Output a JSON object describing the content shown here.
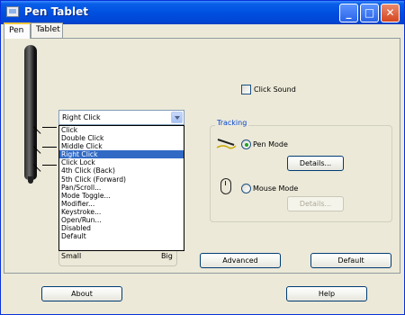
{
  "window": {
    "title": "Pen Tablet",
    "minimize": "_",
    "maximize": "□",
    "close": "✕"
  },
  "tabs": [
    {
      "label": "Pen",
      "active": true
    },
    {
      "label": "Tablet",
      "active": false
    }
  ],
  "pen_buttons": {
    "selected": "Right Click",
    "options": [
      "Click",
      "Double Click",
      "Middle Click",
      "Right Click",
      "Click Lock",
      "4th Click (Back)",
      "5th Click (Forward)",
      "Pan/Scroll...",
      "Mode Toggle...",
      "Modifier...",
      "Keystroke...",
      "Open/Run...",
      "Disabled",
      "Default"
    ]
  },
  "tip_feel": {
    "min_label": "Small",
    "max_label": "Big"
  },
  "click_sound": {
    "label": "Click Sound",
    "checked": false
  },
  "tracking": {
    "group_label": "Tracking",
    "pen_mode": {
      "label": "Pen Mode",
      "selected": true,
      "details": "Details..."
    },
    "mouse_mode": {
      "label": "Mouse Mode",
      "selected": false,
      "details": "Details..."
    }
  },
  "buttons": {
    "advanced": "Advanced",
    "default": "Default",
    "about": "About",
    "help": "Help"
  },
  "colors": {
    "titlebar": "#0050e0",
    "selection": "#316ac5",
    "group_label": "#0046d5",
    "radio_dot": "#21a121"
  }
}
